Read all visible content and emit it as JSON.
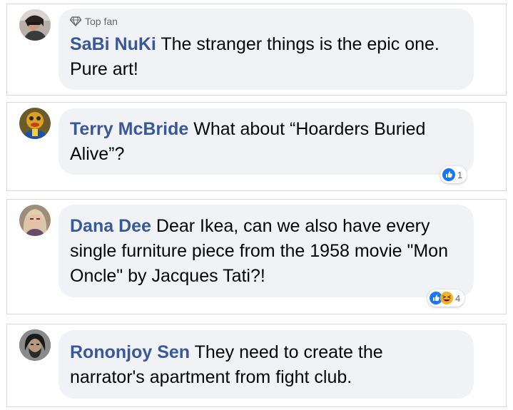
{
  "comments": [
    {
      "author": "SaBi NuKi",
      "text": "The stranger things is the epic one. Pure art!",
      "badge": "Top fan",
      "avatar_icon": "avatar-photo-icon"
    },
    {
      "author": "Terry McBride",
      "text": "What about “Hoarders Buried Alive”?",
      "reaction_count": "1",
      "reactions": [
        "like-icon"
      ]
    },
    {
      "author": "Dana Dee",
      "text": "Dear Ikea, can we also have every single furniture piece from the 1958 movie \"Mon Oncle\" by Jacques Tati?!",
      "reaction_count": "4",
      "reactions": [
        "like-icon",
        "haha-icon"
      ]
    },
    {
      "author": "Rononjoy Sen",
      "text": "They need to create the narrator's apartment from fight club."
    }
  ],
  "colors": {
    "author": "#385898",
    "bubble": "#f0f2f5",
    "like": "#1877f2",
    "haha": "#f7b125",
    "border": "#d5d8dc"
  }
}
